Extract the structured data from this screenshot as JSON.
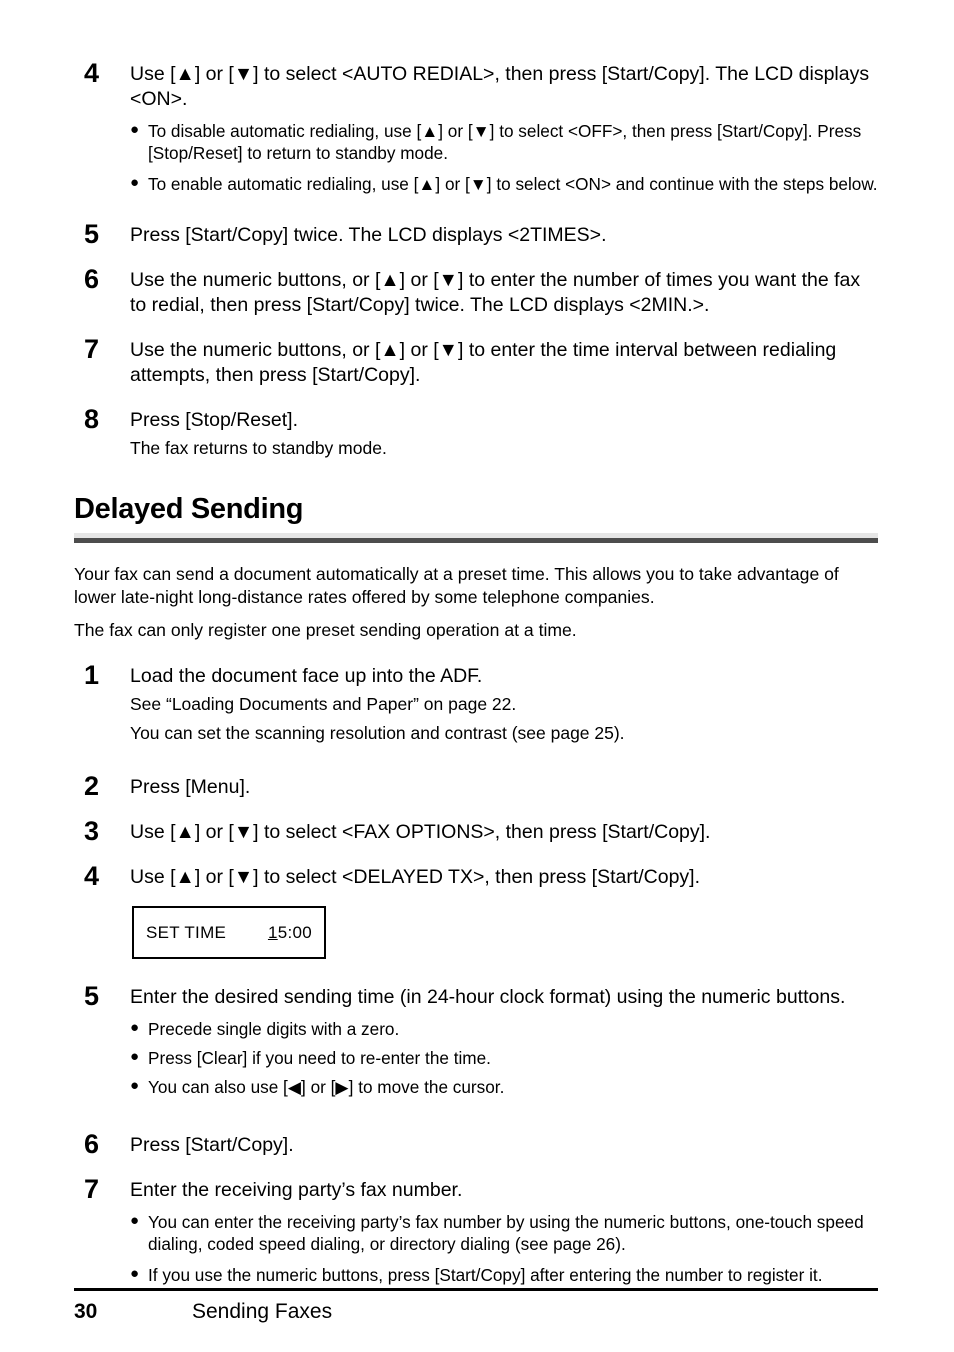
{
  "page": {
    "number": "30",
    "section_title": "Sending Faxes"
  },
  "colors": {
    "text": "#000000",
    "rule_light": "#e6e6e6",
    "rule_dark": "#4d4d4d",
    "footer_rule": "#000000",
    "page_background": "#ffffff"
  },
  "auto_redial_steps": [
    {
      "num": "4",
      "text": "Use [▲] or [▼] to select <AUTO REDIAL>, then press [Start/Copy]. The LCD displays <ON>.",
      "bullets": [
        "To disable automatic redialing, use [▲] or [▼] to select <OFF>, then press [Start/Copy]. Press [Stop/Reset] to return to standby mode.",
        "To enable automatic redialing, use [▲] or [▼] to select <ON> and continue with the steps below."
      ]
    },
    {
      "num": "5",
      "text": "Press [Start/Copy] twice. The LCD displays <2TIMES>."
    },
    {
      "num": "6",
      "text": "Use the numeric buttons, or [▲] or [▼] to enter the number of times you want the fax to redial, then press [Start/Copy] twice. The LCD displays <2MIN.>."
    },
    {
      "num": "7",
      "text": "Use the numeric buttons, or [▲] or [▼] to enter the time interval between redialing attempts, then press [Start/Copy]."
    },
    {
      "num": "8",
      "text": "Press [Stop/Reset].",
      "sub": "The fax returns to standby mode."
    }
  ],
  "section": {
    "heading": "Delayed Sending",
    "intro_paragraph": "Your fax can send a document automatically at a preset time. This allows you to take advantage of lower late-night long-distance rates offered by some telephone companies.",
    "note_paragraph": "The fax can only register one preset sending operation at a time."
  },
  "delayed_steps": [
    {
      "num": "1",
      "text": "Load the document face up into the ADF.",
      "sub1": "See “Loading Documents and Paper” on page 22.",
      "sub2": "You can set the scanning resolution and contrast (see page 25)."
    },
    {
      "num": "2",
      "text": "Press [Menu]."
    },
    {
      "num": "3",
      "text": "Use [▲] or [▼] to select <FAX OPTIONS>, then press [Start/Copy]."
    },
    {
      "num": "4",
      "text": "Use [▲] or [▼] to select <DELAYED TX>, then press [Start/Copy]."
    },
    {
      "num": "5",
      "text": "Enter the desired sending time (in 24-hour clock format) using the numeric buttons.",
      "bullets": [
        "Precede single digits with a zero.",
        "Press [Clear] if you need to re-enter the time.",
        "You can also use [◀] or [▶] to move the cursor."
      ]
    },
    {
      "num": "6",
      "text": "Press [Start/Copy]."
    },
    {
      "num": "7",
      "text": "Enter the receiving party’s fax number.",
      "bullets": [
        "You can enter the receiving party’s fax number by using the numeric buttons, one-touch speed dialing, coded speed dialing, or directory dialing (see page 26).",
        "If you use the numeric buttons, press [Start/Copy] after entering the number to register it."
      ]
    }
  ],
  "lcd_display": {
    "label": "SET TIME",
    "value_cursor_digit": "1",
    "value_rest": "5:00",
    "value_full": "15:00"
  },
  "bullet_glyph": "●"
}
